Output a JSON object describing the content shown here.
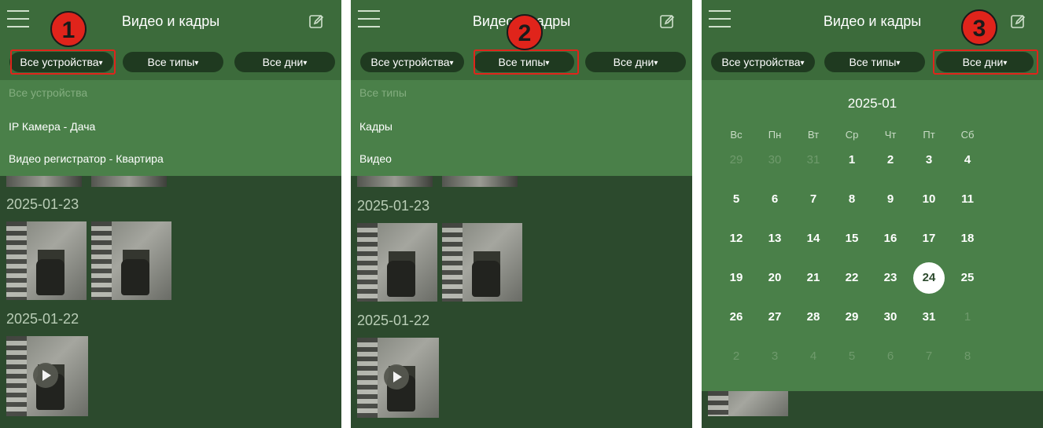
{
  "header": {
    "title": "Видео и кадры"
  },
  "filters": {
    "devices": "Все устройства",
    "types": "Все типы",
    "days": "Все дни",
    "arrow": "▾"
  },
  "panels": [
    {
      "badge": "1",
      "dropdown": [
        "Все устройства",
        "IP Камера - Дача",
        "Видео регистратор - Квартира"
      ]
    },
    {
      "badge": "2",
      "dropdown": [
        "Все типы",
        "Кадры",
        "Видео"
      ]
    },
    {
      "badge": "3"
    }
  ],
  "gallery": {
    "dates": [
      "2025-01-23",
      "2025-01-22"
    ]
  },
  "calendar": {
    "month": "2025-01",
    "weekdays": [
      "Вс",
      "Пн",
      "Вт",
      "Ср",
      "Чт",
      "Пт",
      "Сб"
    ],
    "weeks": [
      [
        "29",
        "30",
        "31",
        "1",
        "2",
        "3",
        "4"
      ],
      [
        "5",
        "6",
        "7",
        "8",
        "9",
        "10",
        "11"
      ],
      [
        "12",
        "13",
        "14",
        "15",
        "16",
        "17",
        "18"
      ],
      [
        "19",
        "20",
        "21",
        "22",
        "23",
        "24",
        "25"
      ],
      [
        "26",
        "27",
        "28",
        "29",
        "30",
        "31",
        "1"
      ],
      [
        "2",
        "3",
        "4",
        "5",
        "6",
        "7",
        "8"
      ]
    ],
    "out_of_month": [
      [
        0,
        0
      ],
      [
        0,
        1
      ],
      [
        0,
        2
      ],
      [
        4,
        6
      ],
      [
        5,
        0
      ],
      [
        5,
        1
      ],
      [
        5,
        2
      ],
      [
        5,
        3
      ],
      [
        5,
        4
      ],
      [
        5,
        5
      ],
      [
        5,
        6
      ]
    ],
    "selected_day": "24"
  },
  "colors": {
    "accent_red": "#e0241b",
    "bar_green": "#3c6b3b",
    "bg_green": "#2c4a2d"
  }
}
